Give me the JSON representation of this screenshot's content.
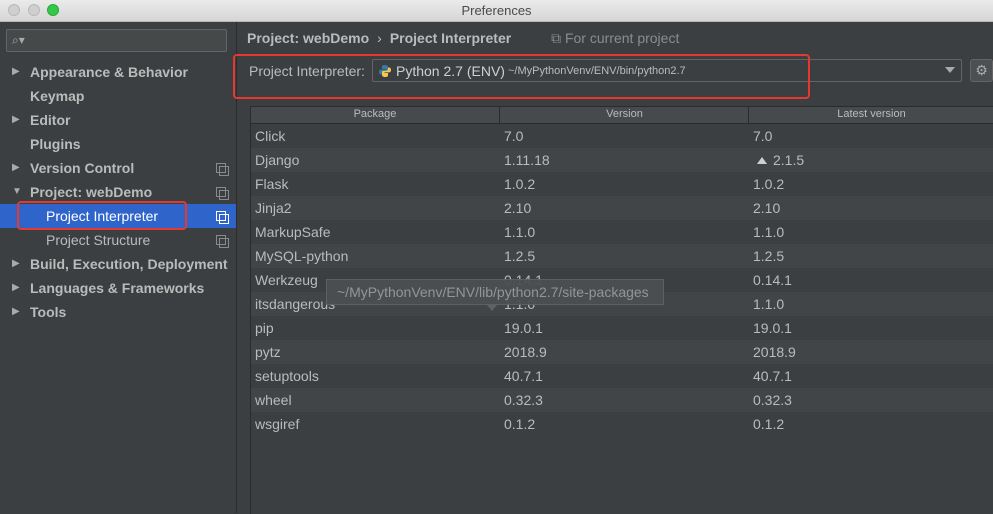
{
  "window": {
    "title": "Preferences"
  },
  "sidebar": {
    "search_placeholder": "",
    "items": [
      {
        "label": "Appearance & Behavior",
        "expandable": true,
        "bold": true,
        "copy_icon": false
      },
      {
        "label": "Keymap",
        "expandable": false,
        "bold": true,
        "copy_icon": false
      },
      {
        "label": "Editor",
        "expandable": true,
        "bold": true,
        "copy_icon": false
      },
      {
        "label": "Plugins",
        "expandable": false,
        "bold": true,
        "copy_icon": false
      },
      {
        "label": "Version Control",
        "expandable": true,
        "bold": true,
        "copy_icon": true
      },
      {
        "label": "Project: webDemo",
        "expandable": true,
        "expanded": true,
        "bold": true,
        "copy_icon": true
      },
      {
        "label": "Project Interpreter",
        "child": true,
        "selected": true,
        "copy_icon": true
      },
      {
        "label": "Project Structure",
        "child": true,
        "copy_icon": true
      },
      {
        "label": "Build, Execution, Deployment",
        "expandable": true,
        "bold": true,
        "copy_icon": false
      },
      {
        "label": "Languages & Frameworks",
        "expandable": true,
        "bold": true,
        "copy_icon": false
      },
      {
        "label": "Tools",
        "expandable": true,
        "bold": true,
        "copy_icon": false
      }
    ]
  },
  "header": {
    "breadcrumb_root": "Project: webDemo",
    "breadcrumb_sep": "›",
    "breadcrumb_page": "Project Interpreter",
    "scope": "For current project"
  },
  "interpreter": {
    "label": "Project Interpreter:",
    "name": "Python 2.7 (ENV)",
    "path": "~/MyPythonVenv/ENV/bin/python2.7"
  },
  "table": {
    "columns": [
      "Package",
      "Version",
      "Latest version"
    ],
    "rows": [
      {
        "package": "Click",
        "version": "7.0",
        "latest": "7.0",
        "upgrade": false
      },
      {
        "package": "Django",
        "version": "1.11.18",
        "latest": "2.1.5",
        "upgrade": true
      },
      {
        "package": "Flask",
        "version": "1.0.2",
        "latest": "1.0.2",
        "upgrade": false
      },
      {
        "package": "Jinja2",
        "version": "2.10",
        "latest": "2.10",
        "upgrade": false
      },
      {
        "package": "MarkupSafe",
        "version": "1.1.0",
        "latest": "1.1.0",
        "upgrade": false
      },
      {
        "package": "MySQL-python",
        "version": "1.2.5",
        "latest": "1.2.5",
        "upgrade": false
      },
      {
        "package": "Werkzeug",
        "version": "0.14.1",
        "latest": "0.14.1",
        "upgrade": false
      },
      {
        "package": "itsdangerous",
        "version": "1.1.0",
        "latest": "1.1.0",
        "upgrade": false
      },
      {
        "package": "pip",
        "version": "19.0.1",
        "latest": "19.0.1",
        "upgrade": false
      },
      {
        "package": "pytz",
        "version": "2018.9",
        "latest": "2018.9",
        "upgrade": false
      },
      {
        "package": "setuptools",
        "version": "40.7.1",
        "latest": "40.7.1",
        "upgrade": false
      },
      {
        "package": "wheel",
        "version": "0.32.3",
        "latest": "0.32.3",
        "upgrade": false
      },
      {
        "package": "wsgiref",
        "version": "0.1.2",
        "latest": "0.1.2",
        "upgrade": false
      }
    ]
  },
  "tooltip": {
    "text": "~/MyPythonVenv/ENV/lib/python2.7/site-packages"
  },
  "colors": {
    "selection": "#2f65ca",
    "highlight_box": "#e5382e",
    "panel": "#3c3f41"
  }
}
